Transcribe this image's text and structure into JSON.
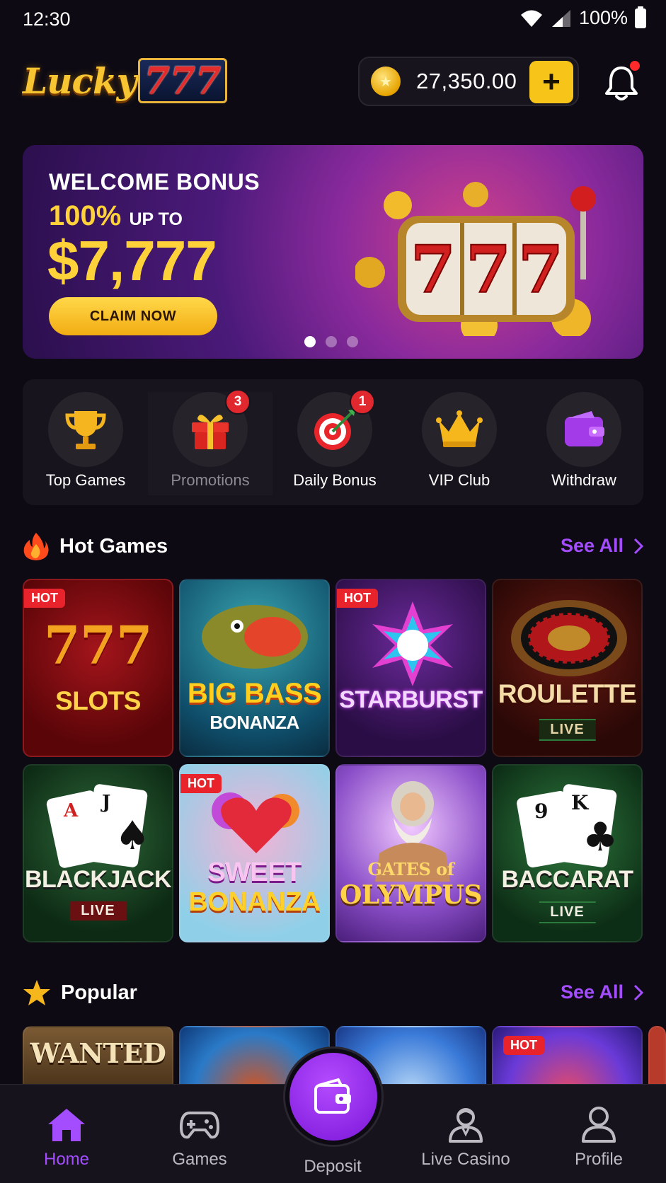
{
  "status_bar": {
    "time": "12:30",
    "battery": "100%"
  },
  "header": {
    "logo_word": "Lucky",
    "logo_number": "777",
    "balance": "27,350.00",
    "add_label": "+"
  },
  "banner": {
    "title": "WELCOME BONUS",
    "percent": "100%",
    "upto": "UP TO",
    "amount": "$7,777",
    "cta": "CLAIM NOW",
    "reel_symbols": [
      "7",
      "7",
      "7"
    ],
    "slide_count": 3,
    "active_slide": 1
  },
  "quick_menu": [
    {
      "label": "Top Games",
      "icon": "trophy-icon",
      "badge": ""
    },
    {
      "label": "Promotions",
      "icon": "gift-icon",
      "badge": "3"
    },
    {
      "label": "Daily Bonus",
      "icon": "target-icon",
      "badge": "1"
    },
    {
      "label": "VIP Club",
      "icon": "crown-icon",
      "badge": ""
    },
    {
      "label": "Withdraw",
      "icon": "wallet-icon",
      "badge": ""
    }
  ],
  "hot_games": {
    "title": "Hot Games",
    "see_all": "See All",
    "games": [
      {
        "name_top": "777",
        "name": "SLOTS",
        "sub": "",
        "tag": "HOT"
      },
      {
        "name_top": "BIG BASS",
        "name": "BONANZA",
        "sub": "",
        "tag": ""
      },
      {
        "name_top": "",
        "name": "STARBURST",
        "sub": "",
        "tag": "HOT"
      },
      {
        "name_top": "",
        "name": "ROULETTE",
        "sub": "LIVE",
        "tag": ""
      },
      {
        "name_top": "A J",
        "name": "BLACKJACK",
        "sub": "LIVE",
        "tag": ""
      },
      {
        "name_top": "SWEET",
        "name": "BONANZA",
        "sub": "",
        "tag": "HOT"
      },
      {
        "name_top": "GATES of",
        "name": "OLYMPUS",
        "sub": "",
        "tag": ""
      },
      {
        "name_top": "9 K",
        "name": "BACCARAT",
        "sub": "LIVE",
        "tag": ""
      }
    ]
  },
  "popular": {
    "title": "Popular",
    "see_all": "See All",
    "games": [
      {
        "name": "WANTED",
        "tag": ""
      },
      {
        "name": "",
        "tag": ""
      },
      {
        "name": "",
        "tag": ""
      },
      {
        "name": "",
        "tag": "HOT"
      }
    ]
  },
  "bottom_nav": {
    "items": [
      {
        "label": "Home",
        "icon": "home-icon",
        "active": true
      },
      {
        "label": "Games",
        "icon": "gamepad-icon",
        "active": false
      },
      {
        "label": "Deposit",
        "icon": "wallet-icon",
        "active": false
      },
      {
        "label": "Live Casino",
        "icon": "dealer-icon",
        "active": false
      },
      {
        "label": "Profile",
        "icon": "user-icon",
        "active": false
      }
    ]
  },
  "colors": {
    "background": "#0d0a14",
    "accent_purple": "#a34dff",
    "gold": "#f7c41a",
    "hot_red": "#e8232b"
  }
}
